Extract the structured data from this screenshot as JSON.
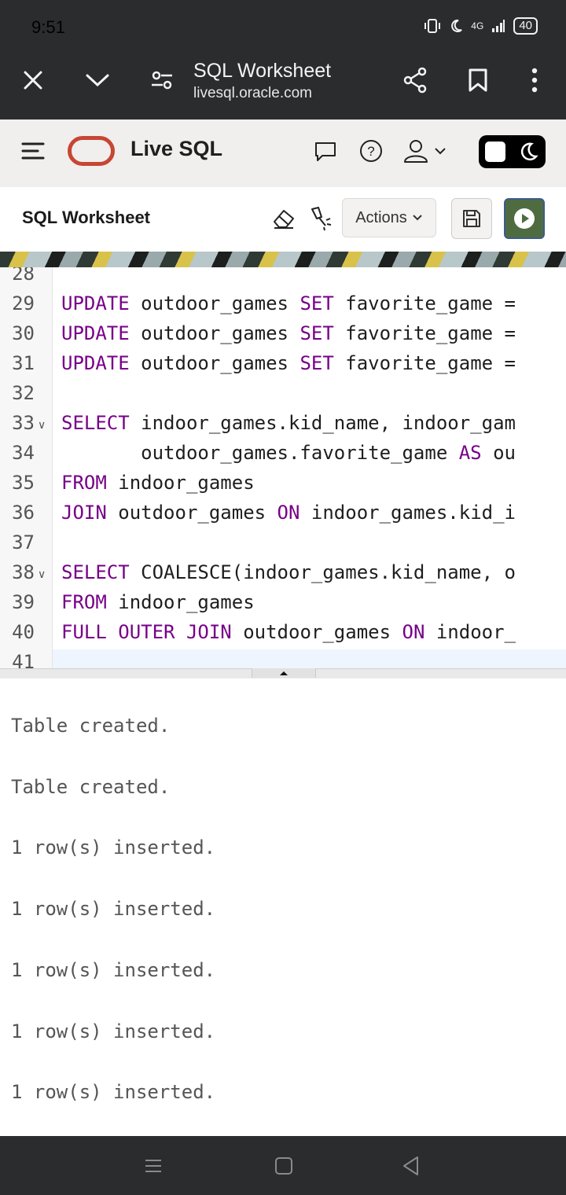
{
  "status_bar": {
    "time": "9:51",
    "network": "4G",
    "battery": "40"
  },
  "browser": {
    "title": "SQL Worksheet",
    "url": "livesql.oracle.com",
    "icons": [
      "close-icon",
      "chevron-down-icon",
      "page-settings-icon",
      "share-icon",
      "bookmark-icon",
      "more-vertical-icon"
    ]
  },
  "app_header": {
    "app_name": "Live SQL"
  },
  "worksheet": {
    "title": "SQL Worksheet",
    "actions_label": "Actions"
  },
  "editor": {
    "lines": [
      {
        "num": "28",
        "tokens": []
      },
      {
        "num": "29",
        "tokens": [
          {
            "t": "UPDATE",
            "kw": true
          },
          {
            "t": " outdoor_games "
          },
          {
            "t": "SET",
            "kw": true
          },
          {
            "t": " favorite_game ="
          }
        ]
      },
      {
        "num": "30",
        "tokens": [
          {
            "t": "UPDATE",
            "kw": true
          },
          {
            "t": " outdoor_games "
          },
          {
            "t": "SET",
            "kw": true
          },
          {
            "t": " favorite_game ="
          }
        ]
      },
      {
        "num": "31",
        "tokens": [
          {
            "t": "UPDATE",
            "kw": true
          },
          {
            "t": " outdoor_games "
          },
          {
            "t": "SET",
            "kw": true
          },
          {
            "t": " favorite_game ="
          }
        ]
      },
      {
        "num": "32",
        "tokens": []
      },
      {
        "num": "33",
        "fold": true,
        "tokens": [
          {
            "t": "SELECT",
            "kw": true
          },
          {
            "t": " indoor_games.kid_name, indoor_gam"
          }
        ]
      },
      {
        "num": "34",
        "tokens": [
          {
            "t": "       outdoor_games.favorite_game "
          },
          {
            "t": "AS",
            "kw": true
          },
          {
            "t": " ou"
          }
        ]
      },
      {
        "num": "35",
        "tokens": [
          {
            "t": "FROM",
            "kw": true
          },
          {
            "t": " indoor_games"
          }
        ]
      },
      {
        "num": "36",
        "tokens": [
          {
            "t": "JOIN",
            "kw": true
          },
          {
            "t": " outdoor_games "
          },
          {
            "t": "ON",
            "kw": true
          },
          {
            "t": " indoor_games.kid_i"
          }
        ]
      },
      {
        "num": "37",
        "tokens": []
      },
      {
        "num": "38",
        "fold": true,
        "tokens": [
          {
            "t": "SELECT",
            "kw": true
          },
          {
            "t": " COALESCE(indoor_games.kid_name, o"
          }
        ]
      },
      {
        "num": "39",
        "tokens": [
          {
            "t": "FROM",
            "kw": true
          },
          {
            "t": " indoor_games"
          }
        ]
      },
      {
        "num": "40",
        "tokens": [
          {
            "t": "FULL OUTER JOIN",
            "kw": true
          },
          {
            "t": " outdoor_games "
          },
          {
            "t": "ON",
            "kw": true
          },
          {
            "t": " indoor_"
          }
        ]
      },
      {
        "num": "41",
        "tokens": []
      }
    ]
  },
  "output": {
    "lines": [
      "Table created.",
      "Table created.",
      "1 row(s) inserted.",
      "1 row(s) inserted.",
      "1 row(s) inserted.",
      "1 row(s) inserted.",
      "1 row(s) inserted."
    ]
  },
  "colors": {
    "keyword": "#770088",
    "brand_red": "#c74634",
    "run_button": "#4f6c40"
  }
}
